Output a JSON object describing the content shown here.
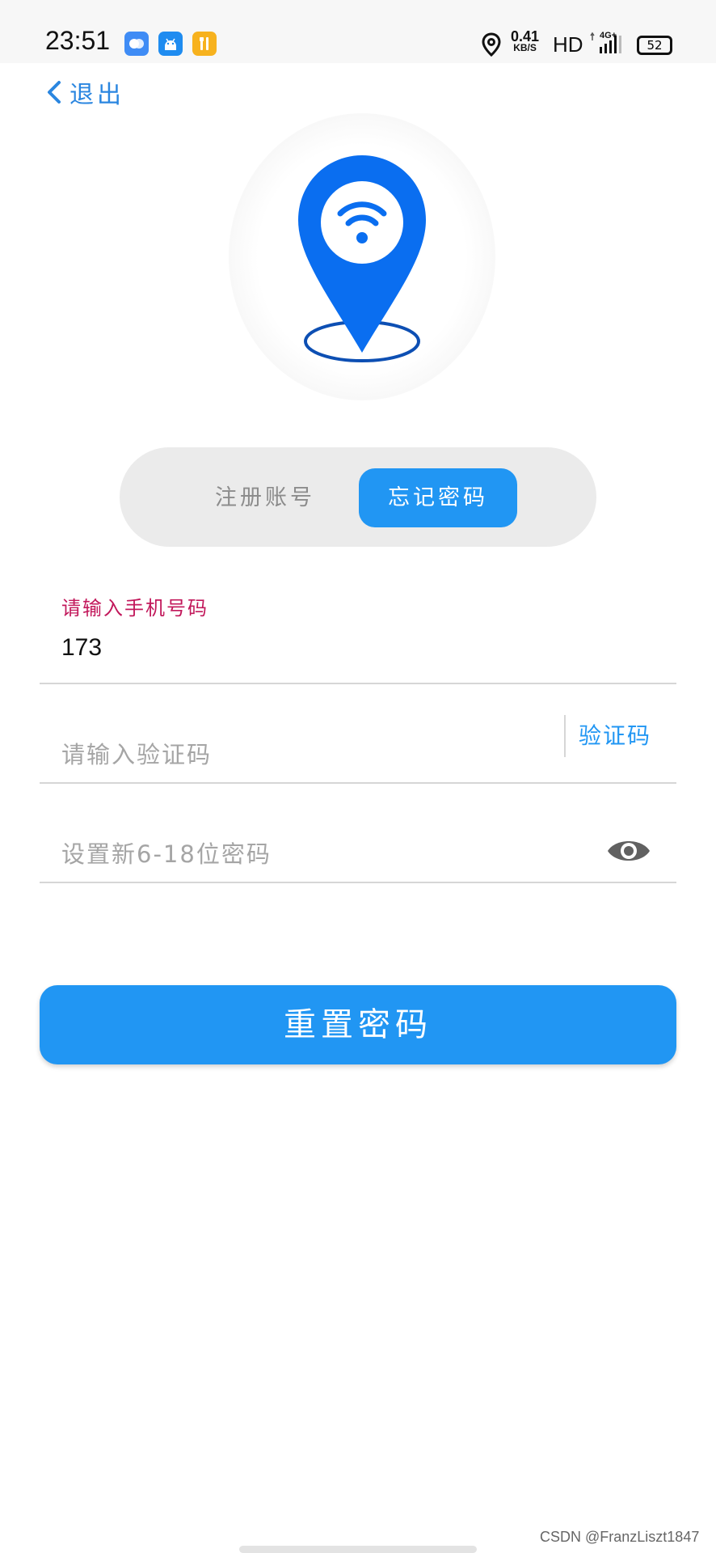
{
  "status_bar": {
    "time": "23:51",
    "apps": [
      {
        "icon": "cloud-app-icon",
        "color": "#3f8cf5"
      },
      {
        "icon": "android-app-icon",
        "color": "#1f8cf0"
      },
      {
        "icon": "toolkit-app-icon",
        "color": "#f7b21e"
      }
    ],
    "net_speed_value": "0.41",
    "net_speed_unit": "KB/S",
    "hd": "HD",
    "network": "4G+",
    "battery": "52"
  },
  "header": {
    "back_label": "退出"
  },
  "tabs": [
    {
      "label": "注册账号",
      "active": false
    },
    {
      "label": "忘记密码",
      "active": true
    }
  ],
  "form": {
    "phone": {
      "label": "请输入手机号码",
      "value": "173"
    },
    "code": {
      "placeholder": "请输入验证码",
      "button": "验证码"
    },
    "password": {
      "placeholder": "设置新6-18位密码"
    },
    "submit_label": "重置密码"
  },
  "colors": {
    "accent": "#2196f3",
    "label": "#c2185b",
    "logo_blue": "#0a6ef0"
  },
  "watermark": "CSDN @FranzLiszt1847"
}
